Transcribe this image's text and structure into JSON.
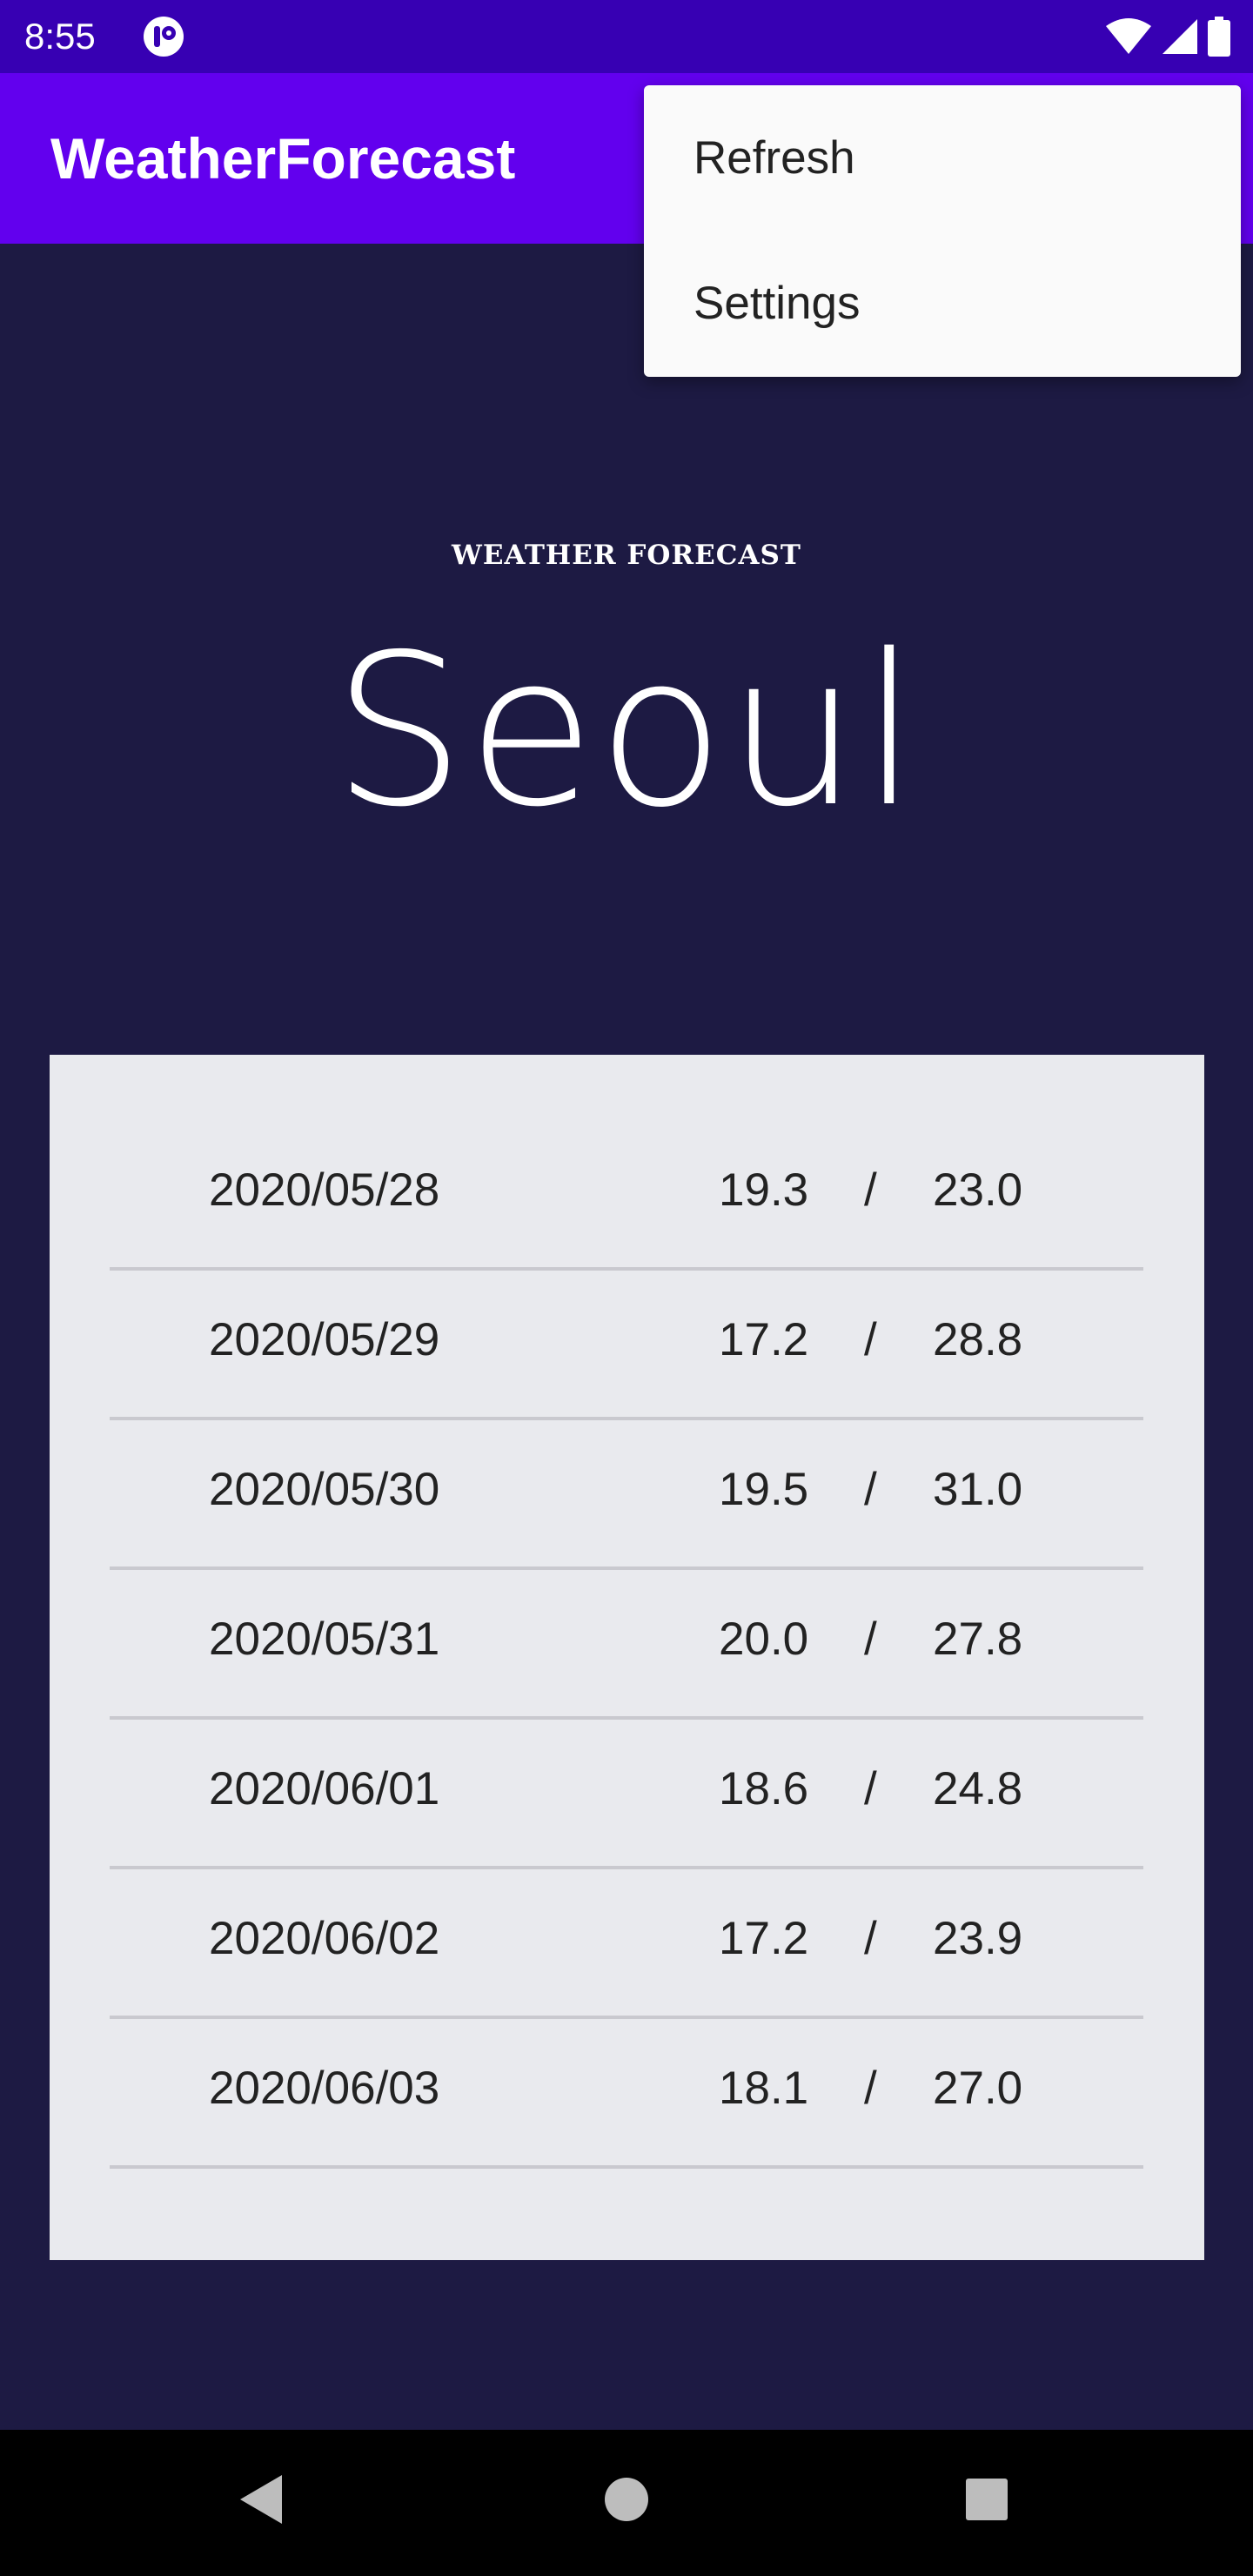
{
  "status_bar": {
    "time": "8:55",
    "icons": [
      "app-notification-icon",
      "wifi-icon",
      "cellular-signal-icon",
      "battery-icon"
    ]
  },
  "app_bar": {
    "title": "WeatherForecast"
  },
  "overflow_menu": {
    "items": [
      {
        "label": "Refresh"
      },
      {
        "label": "Settings"
      }
    ]
  },
  "header": {
    "label": "WEATHER FORECAST",
    "city": "Seoul"
  },
  "forecast": {
    "separator": "/",
    "rows": [
      {
        "date": "2020/05/28",
        "min": "19.3",
        "max": "23.0"
      },
      {
        "date": "2020/05/29",
        "min": "17.2",
        "max": "28.8"
      },
      {
        "date": "2020/05/30",
        "min": "19.5",
        "max": "31.0"
      },
      {
        "date": "2020/05/31",
        "min": "20.0",
        "max": "27.8"
      },
      {
        "date": "2020/06/01",
        "min": "18.6",
        "max": "24.8"
      },
      {
        "date": "2020/06/02",
        "min": "17.2",
        "max": "23.9"
      },
      {
        "date": "2020/06/03",
        "min": "18.1",
        "max": "27.0"
      }
    ]
  },
  "nav_bar": {
    "buttons": [
      "back-icon",
      "home-icon",
      "recents-icon"
    ]
  },
  "colors": {
    "status_bar": "#3700b3",
    "app_bar": "#6200ee",
    "background": "#1d1a43",
    "card": "#e9eaee",
    "menu": "#fafafa"
  }
}
